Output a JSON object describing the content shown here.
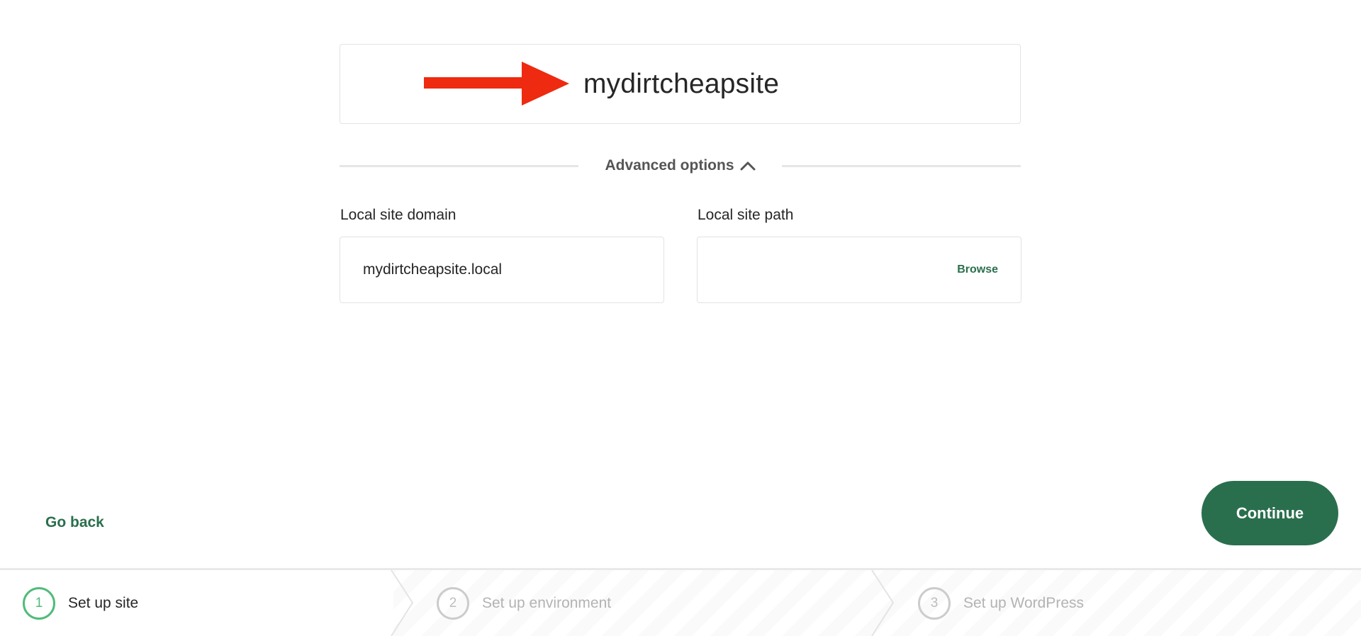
{
  "site_name": {
    "value": "mydirtcheapsite",
    "annotation_icon": "red-arrow-icon",
    "annotation_color": "#ee2a10"
  },
  "advanced": {
    "label": "Advanced options",
    "icon": "chevron-up-icon",
    "expanded": true
  },
  "fields": {
    "domain": {
      "label": "Local site domain",
      "value": "mydirtcheapsite.local"
    },
    "path": {
      "label": "Local site path",
      "value": "",
      "browse_label": "Browse"
    }
  },
  "actions": {
    "go_back": "Go back",
    "continue": "Continue"
  },
  "stepper": {
    "steps": [
      {
        "number": "1",
        "label": "Set up site",
        "active": true
      },
      {
        "number": "2",
        "label": "Set up environment",
        "active": false
      },
      {
        "number": "3",
        "label": "Set up WordPress",
        "active": false
      }
    ]
  },
  "colors": {
    "accent": "#2a6f4d",
    "step_active": "#51bb7b",
    "annotation": "#ee2a10"
  }
}
